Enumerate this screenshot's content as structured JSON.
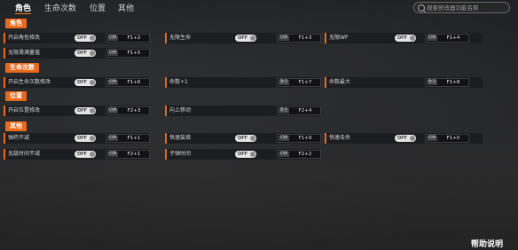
{
  "nav": {
    "tabs": [
      "角色",
      "生命次数",
      "位置",
      "其他"
    ],
    "active_tab": "角色"
  },
  "search": {
    "placeholder": "搜索修改器功能名称"
  },
  "sections": [
    {
      "title": "角色",
      "rows": [
        [
          {
            "label": "开启角色修改",
            "kind": "toggle",
            "state": "OFF",
            "action": "切换",
            "hotkey": "F1+2"
          },
          {
            "label": "无限生命",
            "kind": "toggle",
            "state": "OFF",
            "action": "切换",
            "hotkey": "F1+3"
          },
          {
            "label": "无限WP",
            "kind": "toggle",
            "state": "OFF",
            "action": "切换",
            "hotkey": "F1+4"
          }
        ],
        [
          {
            "label": "无限滑满量值",
            "kind": "toggle",
            "state": "OFF",
            "action": "切换",
            "hotkey": "F1+5"
          }
        ]
      ]
    },
    {
      "title": "生命次数",
      "rows": [
        [
          {
            "label": "开启生命次数修改",
            "kind": "toggle",
            "state": "OFF",
            "action": "切换",
            "hotkey": "F1+6"
          },
          {
            "label": "命数+1",
            "kind": "button",
            "action": "激活",
            "hotkey": "F1+7"
          },
          {
            "label": "命数最大",
            "kind": "button",
            "action": "激活",
            "hotkey": "F1+8"
          }
        ]
      ]
    },
    {
      "title": "位置",
      "rows": [
        [
          {
            "label": "开启位置修改",
            "kind": "toggle",
            "state": "OFF",
            "action": "切换",
            "hotkey": "F2+3"
          },
          {
            "label": "向上移动",
            "kind": "button",
            "action": "激活",
            "hotkey": "F2+4"
          }
        ]
      ]
    },
    {
      "title": "其他",
      "rows": [
        [
          {
            "label": "弹药不减",
            "kind": "toggle",
            "state": "OFF",
            "action": "切换",
            "hotkey": "F1+1"
          },
          {
            "label": "快速装填",
            "kind": "toggle",
            "state": "OFF",
            "action": "切换",
            "hotkey": "F1+9"
          },
          {
            "label": "快速击杀",
            "kind": "toggle",
            "state": "OFF",
            "action": "切换",
            "hotkey": "F1+0"
          }
        ],
        [
          {
            "label": "无敌时间不减",
            "kind": "toggle",
            "state": "OFF",
            "action": "切换",
            "hotkey": "F2+1"
          },
          {
            "label": "子弹时间",
            "kind": "toggle",
            "state": "OFF",
            "action": "切换",
            "hotkey": "F2+2"
          }
        ]
      ]
    }
  ],
  "help_label": "帮助说明",
  "colors": {
    "accent": "#e8691c",
    "row_bg": "#1c1d20",
    "toggle_off": "#e4e4e4"
  }
}
